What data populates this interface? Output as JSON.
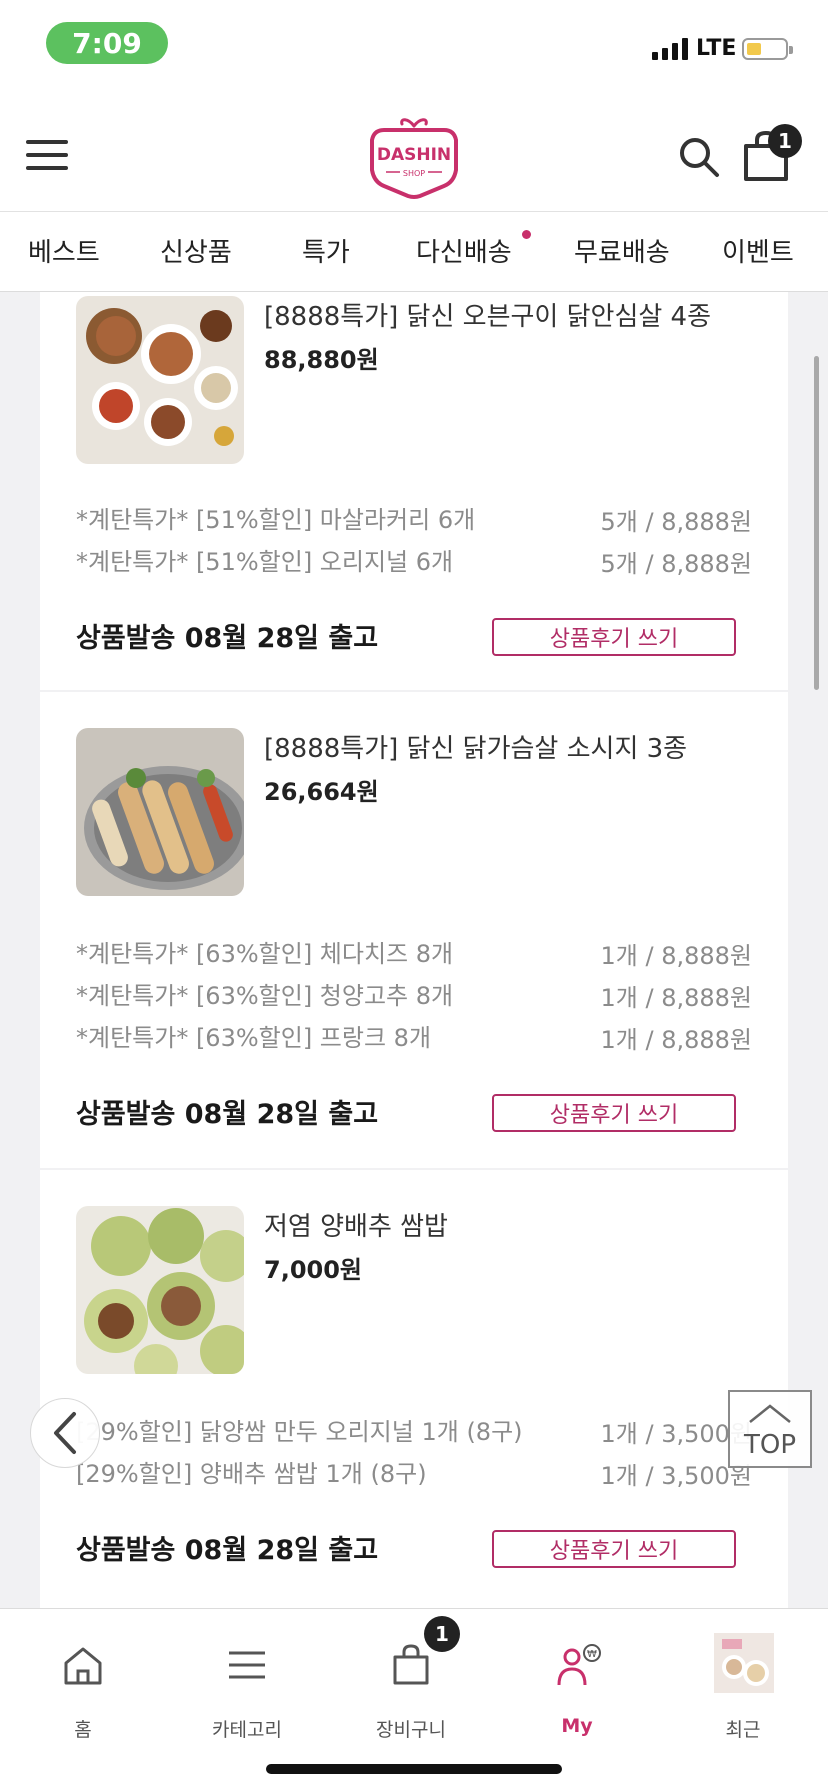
{
  "status_bar": {
    "time": "7:09",
    "network": "LTE"
  },
  "header": {
    "logo_text": "DASHIN",
    "logo_sub": "SHOP",
    "cart_count": "1"
  },
  "categories": [
    "베스트",
    "신상품",
    "특가",
    "다신배송",
    "무료배송",
    "이벤트"
  ],
  "orders": [
    {
      "name": "[8888특가] 닭신 오븐구이 닭안심살 4종",
      "price": "88,880원",
      "options": [
        {
          "name": "*계탄특가* [51%할인] 마살라커리 6개",
          "qty": "5개 / 8,888원"
        },
        {
          "name": "*계탄특가* [51%할인] 오리지널 6개",
          "qty": "5개 / 8,888원"
        }
      ],
      "shipping": "상품발송  08월 28일 출고",
      "review_label": "상품후기 쓰기"
    },
    {
      "name": "[8888특가] 닭신 닭가슴살 소시지 3종",
      "price": "26,664원",
      "options": [
        {
          "name": "*계탄특가* [63%할인] 체다치즈 8개",
          "qty": "1개 / 8,888원"
        },
        {
          "name": "*계탄특가* [63%할인] 청양고추 8개",
          "qty": "1개 / 8,888원"
        },
        {
          "name": "*계탄특가* [63%할인] 프랑크 8개",
          "qty": "1개 / 8,888원"
        }
      ],
      "shipping": "상품발송  08월 28일 출고",
      "review_label": "상품후기 쓰기"
    },
    {
      "name": "저염 양배추 쌈밥",
      "price": "7,000원",
      "options": [
        {
          "name": "[29%할인] 닭양쌈 만두 오리지널 1개 (8구)",
          "qty": "1개 / 3,500원"
        },
        {
          "name": "[29%할인] 양배추 쌈밥 1개 (8구)",
          "qty": "1개 / 3,500원"
        }
      ],
      "shipping": "상품발송  08월 28일 출고",
      "review_label": "상품후기 쓰기"
    }
  ],
  "floating": {
    "top_label": "TOP"
  },
  "tabbar": {
    "items": [
      "홈",
      "카테고리",
      "장비구니",
      "My",
      "최근"
    ],
    "cart_badge": "1"
  },
  "colors": {
    "brand": "#c8306b",
    "review_border": "#b12d66",
    "time_pill": "#5cc15f"
  },
  "icons": [
    "menu-icon",
    "search-icon",
    "shopping-bag-icon",
    "chevron-left-icon",
    "chevron-up-icon",
    "home-icon",
    "category-list-icon",
    "cart-icon",
    "user-points-icon"
  ]
}
